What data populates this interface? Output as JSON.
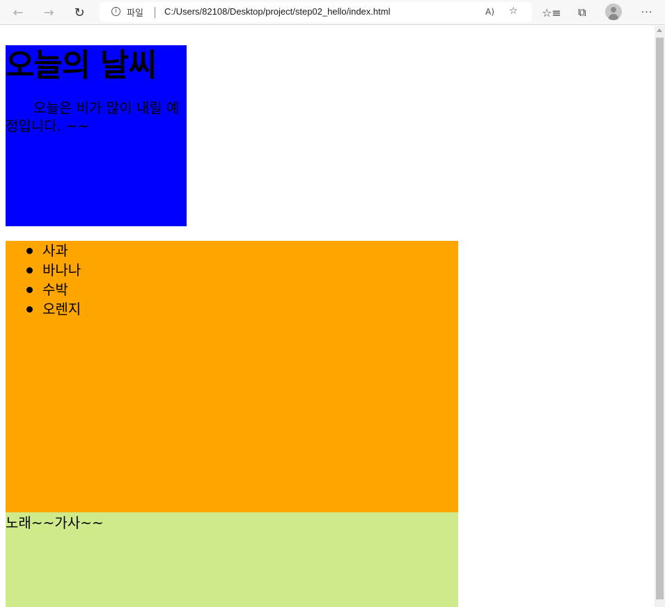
{
  "browser": {
    "back_icon": "←",
    "forward_icon": "→",
    "reload_icon": "↻",
    "info_icon": "i",
    "protocol_label": "파일",
    "url": "C:/Users/82108/Desktop/project/step02_hello/index.html",
    "read_aloud_icon": "A)",
    "favorite_add_icon": "☆",
    "favorites_icon": "☆≡",
    "collections_icon": "⧉",
    "more_icon": "···"
  },
  "weather": {
    "title": "오늘의 날씨",
    "description": "오늘은 비가 많이 내릴 예정입니다. ~~",
    "background_color": "#0000ff"
  },
  "fruits": {
    "background_color": "#ffa500",
    "items": [
      "사과",
      "바나나",
      "수박",
      "오렌지"
    ]
  },
  "lyrics": {
    "text": "노래~~가사~~",
    "background_color": "#cfea8a"
  }
}
